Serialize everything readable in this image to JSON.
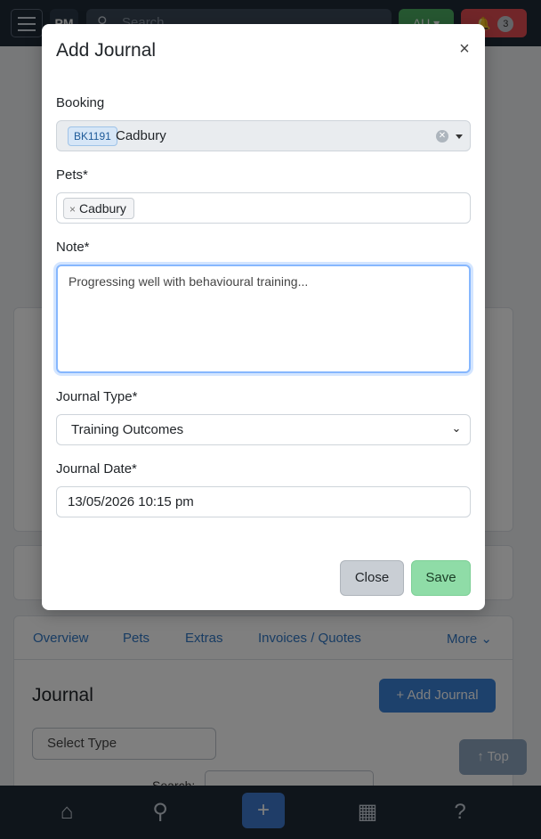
{
  "background": {
    "logo_text": "PM",
    "search_placeholder": "Search",
    "region_button": "AU",
    "notifications_count": "3",
    "tabs": [
      {
        "label": "Overview"
      },
      {
        "label": "Pets"
      },
      {
        "label": "Extras"
      },
      {
        "label": "Invoices / Quotes"
      },
      {
        "label": "More"
      }
    ],
    "journal_title": "Journal",
    "add_journal_label": "Add Journal",
    "select_type_label": "Select Type",
    "search_label": "Search:",
    "top_button_label": "Top"
  },
  "modal": {
    "title": "Add Journal",
    "close_symbol": "×",
    "booking": {
      "label": "Booking",
      "badge": "BK1191",
      "value": "Cadbury"
    },
    "pets": {
      "label": "Pets*",
      "chips": [
        {
          "name": "Cadbury"
        }
      ]
    },
    "note": {
      "label": "Note*",
      "value": "Progressing well with behavioural training..."
    },
    "journal_type": {
      "label": "Journal Type*",
      "selected": "Training Outcomes"
    },
    "journal_date": {
      "label": "Journal Date*",
      "value": "13/05/2026 10:15 pm"
    },
    "close_button": "Close",
    "save_button": "Save"
  },
  "colors": {
    "nav_bg": "#1f2a37",
    "primary": "#3b82d8",
    "save": "#8fdca7",
    "close": "#c9ced4",
    "focus_border": "#86b7fe"
  }
}
